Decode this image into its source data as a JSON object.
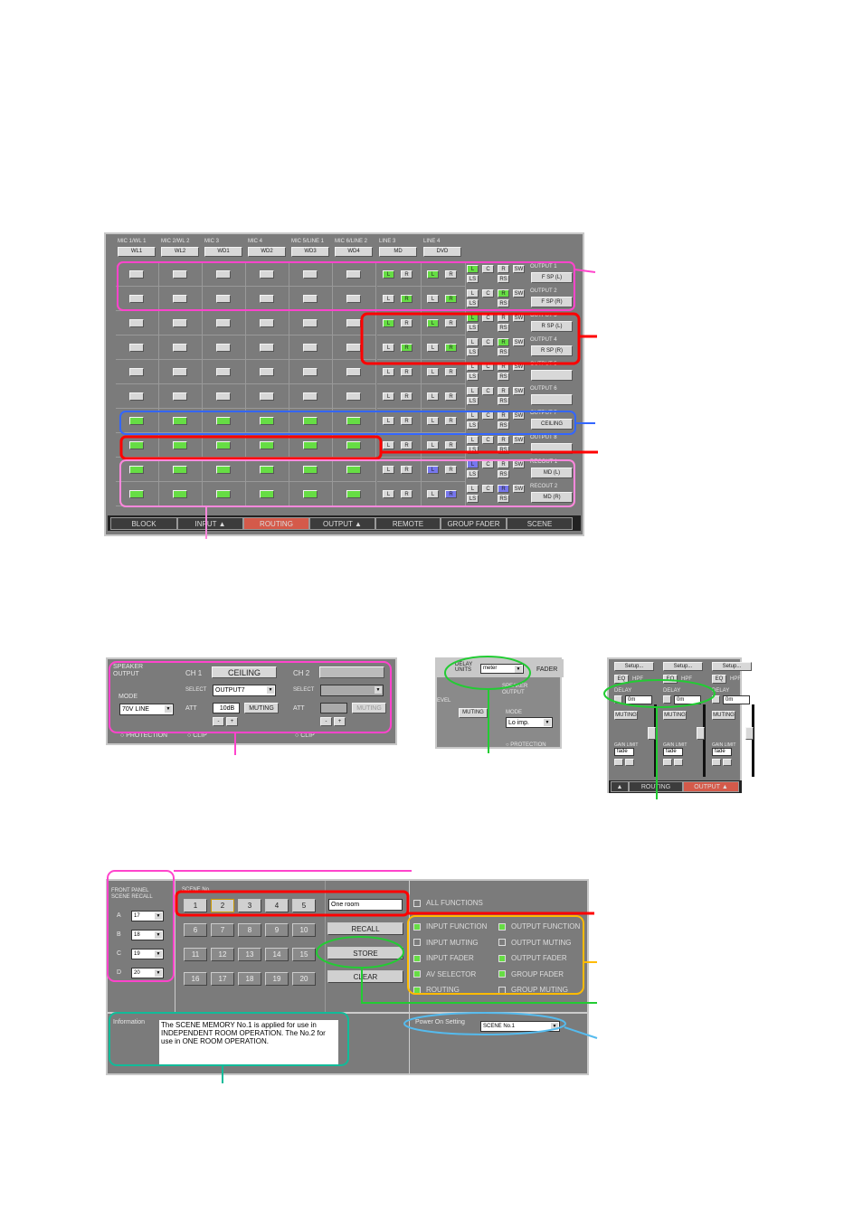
{
  "routing": {
    "inputs": [
      {
        "label": "MIC 1/WL 1",
        "name": "WL1"
      },
      {
        "label": "MIC 2/WL 2",
        "name": "WL2"
      },
      {
        "label": "MIC 3",
        "name": "WD1"
      },
      {
        "label": "MIC 4",
        "name": "WD2"
      },
      {
        "label": "MIC 5/LINE 1",
        "name": "WD3"
      },
      {
        "label": "MIC 6/LINE 2",
        "name": "WD4"
      },
      {
        "label": "LINE 3",
        "name": "MD"
      },
      {
        "label": "LINE 4",
        "name": "DVD"
      }
    ],
    "lr": [
      "L",
      "R"
    ],
    "matrix_top": [
      "L",
      "C",
      "R",
      "SW"
    ],
    "matrix_bottom": [
      "LS",
      "RS"
    ],
    "rows": [
      {
        "label": "OUTPUT 1",
        "name": "F SP (L)",
        "mic": "off",
        "l3": "L",
        "l4": "L",
        "mx": "L",
        "color": "g"
      },
      {
        "label": "OUTPUT 2",
        "name": "F SP (R)",
        "mic": "off",
        "l3": "R",
        "l4": "R",
        "mx": "R",
        "color": "g"
      },
      {
        "label": "OUTPUT 3",
        "name": "R SP (L)",
        "mic": "off",
        "l3": "L",
        "l4": "L",
        "mx": "L",
        "color": "g"
      },
      {
        "label": "OUTPUT 4",
        "name": "R SP (R)",
        "mic": "off",
        "l3": "R",
        "l4": "R",
        "mx": "R",
        "color": "g"
      },
      {
        "label": "OUTPUT 5",
        "name": "",
        "mic": "off",
        "l3": "",
        "l4": "",
        "mx": "",
        "color": "g"
      },
      {
        "label": "OUTPUT 6",
        "name": "",
        "mic": "off",
        "l3": "",
        "l4": "",
        "mx": "",
        "color": "g"
      },
      {
        "label": "OUTPUT 7",
        "name": "CEILING",
        "mic": "on",
        "l3": "",
        "l4": "",
        "mx": "",
        "color": "g"
      },
      {
        "label": "OUTPUT 8",
        "name": "",
        "mic": "on",
        "l3": "",
        "l4": "",
        "mx": "",
        "color": "g"
      },
      {
        "label": "RECOUT 1",
        "name": "MD (L)",
        "mic": "on",
        "l3": "",
        "l4": "L",
        "mx": "L",
        "color": "b"
      },
      {
        "label": "RECOUT 2",
        "name": "MD (R)",
        "mic": "on",
        "l3": "",
        "l4": "R",
        "mx": "R",
        "color": "b"
      }
    ],
    "tabs": [
      {
        "label": "BLOCK"
      },
      {
        "label": "INPUT ▲"
      },
      {
        "label": "ROUTING",
        "active": true
      },
      {
        "label": "OUTPUT ▲"
      },
      {
        "label": "REMOTE"
      },
      {
        "label": "GROUP FADER"
      },
      {
        "label": "SCENE"
      }
    ]
  },
  "speaker": {
    "title1": "SPEAKER",
    "title2": "OUTPUT",
    "mode_label": "MODE",
    "mode": "70V LINE",
    "ch1": "CH 1",
    "ch1_name": "CEILING",
    "select": "SELECT",
    "ch1_select": "OUTPUT7",
    "att": "ATT",
    "ch1_att": "10dB",
    "muting": "MUTING",
    "minus": "-",
    "plus": "+",
    "ch2": "CH 2",
    "protection": "PROTECTION",
    "clip": "CLIP"
  },
  "delay": {
    "units_label1": "DELAY",
    "units_label2": "UNITS",
    "units": "meter",
    "fader": "FADER",
    "level": "EVEL",
    "muting": "MUTING",
    "sp1": "SPEAKER",
    "sp2": "OUTPUT",
    "mode_label": "MODE",
    "mode": "Lo imp.",
    "protection": "PROTECTION"
  },
  "outstrip": {
    "setup": "Setup...",
    "eq": "EQ",
    "hpf": "HPF",
    "delay": "DELAY",
    "delay_val": "0m",
    "muting": "MUTING",
    "gain_limit": "GAIN LIMIT",
    "limit_val": "fade",
    "tabs": [
      {
        "label": "▲"
      },
      {
        "label": "ROUTING"
      },
      {
        "label": "OUTPUT ▲",
        "active": true
      }
    ]
  },
  "scene": {
    "fp_title1": "FRONT PANEL",
    "fp_title2": "SCENE RECALL",
    "fp": [
      {
        "k": "A",
        "v": "17"
      },
      {
        "k": "B",
        "v": "18"
      },
      {
        "k": "C",
        "v": "19"
      },
      {
        "k": "D",
        "v": "20"
      }
    ],
    "setup_label": "SCENE No.",
    "numbers": [
      "1",
      "2",
      "3",
      "4",
      "5",
      "6",
      "7",
      "8",
      "9",
      "10",
      "11",
      "12",
      "13",
      "14",
      "15",
      "16",
      "17",
      "18",
      "19",
      "20"
    ],
    "name": "One room",
    "recall": "RECALL",
    "store": "STORE",
    "clear": "CLEAR",
    "all": "ALL FUNCTIONS",
    "functions": [
      {
        "l": "INPUT FUNCTION",
        "on": true
      },
      {
        "l": "OUTPUT FUNCTION",
        "on": true
      },
      {
        "l": "INPUT MUTING",
        "on": false
      },
      {
        "l": "OUTPUT MUTING",
        "on": false
      },
      {
        "l": "INPUT FADER",
        "on": true
      },
      {
        "l": "OUTPUT FADER",
        "on": true
      },
      {
        "l": "AV SELECTOR",
        "on": true
      },
      {
        "l": "GROUP FADER",
        "on": true
      },
      {
        "l": "ROUTING",
        "on": true
      },
      {
        "l": "GROUP MUTING",
        "on": false
      }
    ],
    "info_label": "Information",
    "info": "The SCENE MEMORY No.1 is applied for use in INDEPENDENT ROOM OPERATION. The No.2 for use in ONE ROOM OPERATION.",
    "power_label": "Power On Setting",
    "power": "SCENE No.1"
  },
  "colors": {
    "green": "#66dd44",
    "blue": "#7777ee",
    "active_tab": "#d45a4a",
    "pink": "#ff44cc",
    "red": "#ff0000",
    "blue_ann": "#3366ff",
    "green_ann": "#22cc33",
    "yellow": "#ffbb00",
    "teal": "#11bb99",
    "light_blue": "#55bbee"
  }
}
